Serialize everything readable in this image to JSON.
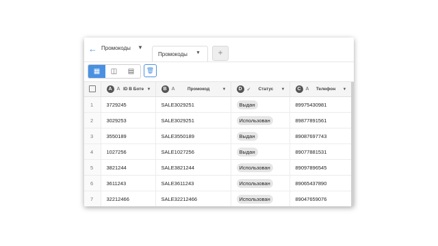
{
  "header": {
    "view_name": "Промокоды",
    "active_tab": "Промокоды",
    "add_tab": "+"
  },
  "toolbar": {
    "icons": [
      "grid-view-icon",
      "column-view-icon",
      "calendar-view-icon",
      "trash-icon"
    ]
  },
  "columns": [
    {
      "badge": "A",
      "type_icon": "A",
      "label": "ID В Боте"
    },
    {
      "badge": "B",
      "type_icon": "A",
      "label": "Промокод"
    },
    {
      "badge": "D",
      "type_icon": "✓",
      "label": "Статус"
    },
    {
      "badge": "C",
      "type_icon": "A",
      "label": "Телефон"
    }
  ],
  "rows": [
    {
      "n": "1",
      "id": "3729245",
      "code": "SALE3029251",
      "status": "Выдан",
      "phone": "89975430981"
    },
    {
      "n": "2",
      "id": "3029253",
      "code": "SALE3029251",
      "status": "Использован",
      "phone": "89877891561"
    },
    {
      "n": "3",
      "id": "3550189",
      "code": "SALE3550189",
      "status": "Выдан",
      "phone": "89087697743"
    },
    {
      "n": "4",
      "id": "1027256",
      "code": "SALE1027256",
      "status": "Выдан",
      "phone": "89077881531"
    },
    {
      "n": "5",
      "id": "3821244",
      "code": "SALE3821244",
      "status": "Использован",
      "phone": "89097896545"
    },
    {
      "n": "6",
      "id": "3611243",
      "code": "SALE3611243",
      "status": "Использован",
      "phone": "89065437890"
    },
    {
      "n": "7",
      "id": "32212466",
      "code": "SALE32212466",
      "status": "Использован",
      "phone": "89047659076"
    }
  ]
}
